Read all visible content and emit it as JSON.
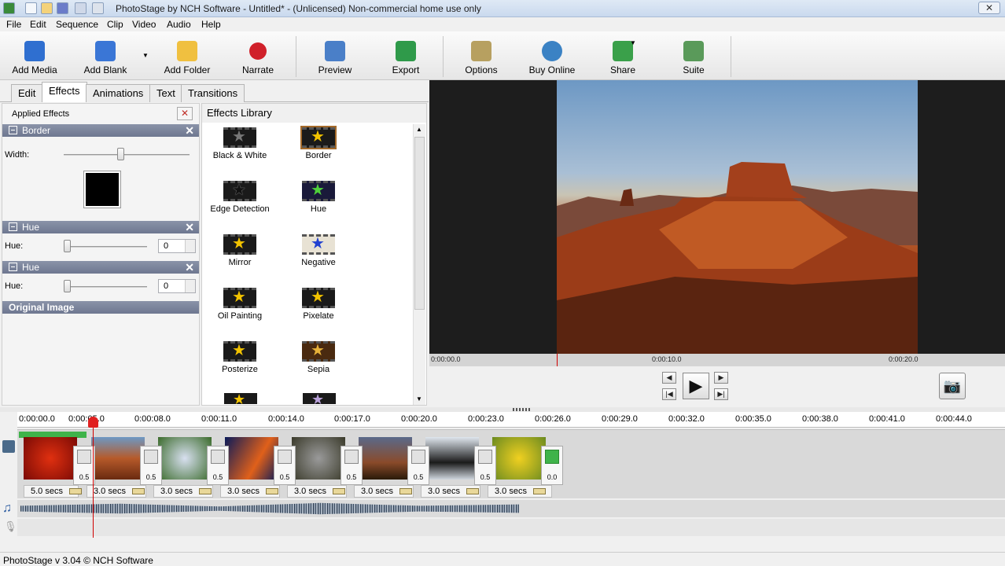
{
  "window": {
    "title": "PhotoStage by NCH Software - Untitled* - (Unlicensed) Non-commercial home use only",
    "close": "✕"
  },
  "menu": [
    "File",
    "Edit",
    "Sequence",
    "Clip",
    "Video",
    "Audio",
    "Help"
  ],
  "toolbar": [
    {
      "label": "Add Media",
      "icon": "add-media-icon",
      "color": "#2f6fd0"
    },
    {
      "label": "Add Blank",
      "icon": "add-blank-icon",
      "color": "#3a76d6"
    },
    {
      "label": "Add Folder",
      "icon": "add-folder-icon",
      "color": "#f0c040"
    },
    {
      "label": "Narrate",
      "icon": "record-icon",
      "color": "#d0202a"
    },
    {
      "label": "Preview",
      "icon": "preview-icon",
      "color": "#4a7fc8"
    },
    {
      "label": "Export",
      "icon": "export-icon",
      "color": "#2f9a4a"
    },
    {
      "label": "Options",
      "icon": "options-icon",
      "color": "#b7a060"
    },
    {
      "label": "Buy Online",
      "icon": "globe-icon",
      "color": "#3b82c4"
    },
    {
      "label": "Share",
      "icon": "share-icon",
      "color": "#3aa04a"
    },
    {
      "label": "Suite",
      "icon": "suite-icon",
      "color": "#5a9a5a"
    }
  ],
  "tabs": [
    "Edit",
    "Effects",
    "Animations",
    "Text",
    "Transitions"
  ],
  "applied": {
    "title": "Applied Effects",
    "border": {
      "name": "Border",
      "width_label": "Width:",
      "width_level": 0.45,
      "color": "#000000"
    },
    "hue1": {
      "name": "Hue",
      "label": "Hue:",
      "value": "0"
    },
    "hue2": {
      "name": "Hue",
      "label": "Hue:",
      "value": "0"
    },
    "original": "Original Image"
  },
  "library": {
    "title": "Effects Library",
    "effects": [
      "Black & White",
      "Border",
      "Edge Detection",
      "Hue",
      "Mirror",
      "Negative",
      "Oil Painting",
      "Pixelate",
      "Posterize",
      "Sepia"
    ]
  },
  "preview_ruler": [
    "0:00:00.0",
    "0:00:10.0",
    "0:00:20.0"
  ],
  "timeline": {
    "ruler": [
      "0:00:00.0",
      "0:00:05.0",
      "0:00:08.0",
      "0:00:11.0",
      "0:00:14.0",
      "0:00:17.0",
      "0:00:20.0",
      "0:00:23.0",
      "0:00:26.0",
      "0:00:29.0",
      "0:00:32.0",
      "0:00:35.0",
      "0:00:38.0",
      "0:00:41.0",
      "0:00:44.0"
    ],
    "durations": [
      "5.0 secs",
      "3.0 secs",
      "3.0 secs",
      "3.0 secs",
      "3.0 secs",
      "3.0 secs",
      "3.0 secs",
      "3.0 secs"
    ],
    "transitions": [
      "0.5",
      "0.5",
      "0.5",
      "0.5",
      "0.5",
      "0.5",
      "0.5",
      "0.0"
    ]
  },
  "status": "PhotoStage v 3.04 © NCH Software"
}
